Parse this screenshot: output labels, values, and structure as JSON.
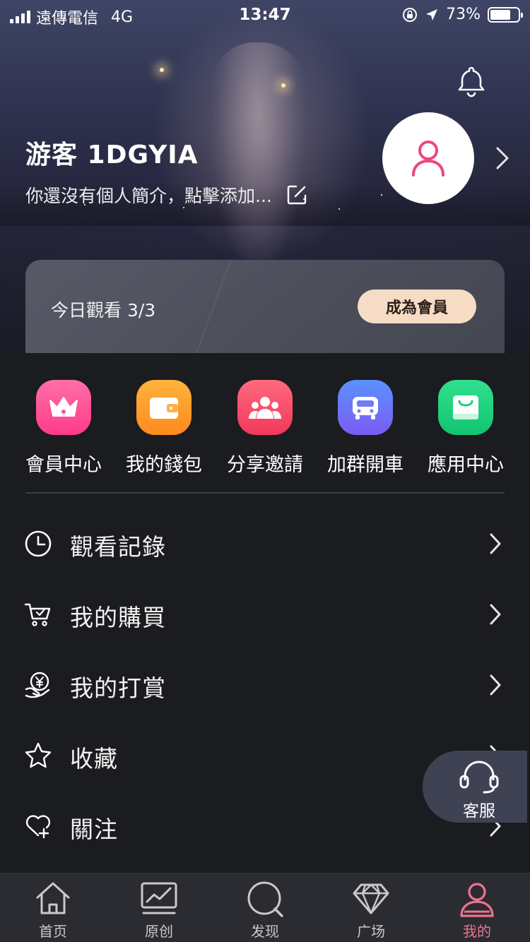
{
  "status_bar": {
    "carrier": "遠傳電信",
    "network": "4G",
    "time": "13:47",
    "battery": "73%",
    "battery_level": 0.73
  },
  "profile": {
    "username": "游客 1DGYIA",
    "bio": "你還沒有個人簡介，點擊添加...",
    "avatar_icon": "user-icon",
    "accent_color": "#f0457f"
  },
  "vip": {
    "watch_today": "今日觀看 3/3",
    "join_label": "成為會員"
  },
  "quick_actions": [
    {
      "label": "會員中心",
      "icon": "crown-icon",
      "color_top": "#ff6fa8",
      "color_bottom": "#ff3b8a"
    },
    {
      "label": "我的錢包",
      "icon": "wallet-icon",
      "color_top": "#ffb23d",
      "color_bottom": "#ff8a1f"
    },
    {
      "label": "分享邀請",
      "icon": "group-icon",
      "color_top": "#ff6a7f",
      "color_bottom": "#f2385a"
    },
    {
      "label": "加群開車",
      "icon": "car-icon",
      "color_top": "#5a92ff",
      "color_bottom": "#7a5cf2"
    },
    {
      "label": "應用中心",
      "icon": "bag-icon",
      "color_top": "#2fe08e",
      "color_bottom": "#12c46f"
    }
  ],
  "menu": [
    {
      "label": "觀看記錄",
      "icon": "clock-icon"
    },
    {
      "label": "我的購買",
      "icon": "cart-icon"
    },
    {
      "label": "我的打賞",
      "icon": "yen-hand-icon"
    },
    {
      "label": "收藏",
      "icon": "star-icon"
    },
    {
      "label": "關注",
      "icon": "heart-plus-icon"
    }
  ],
  "support": {
    "label": "客服",
    "icon": "headset-icon"
  },
  "tabs": [
    {
      "label": "首页",
      "icon": "home-icon"
    },
    {
      "label": "原创",
      "icon": "chart-icon"
    },
    {
      "label": "发现",
      "icon": "discover-icon"
    },
    {
      "label": "广场",
      "icon": "diamond-icon"
    },
    {
      "label": "我的",
      "icon": "profile-icon",
      "active": true,
      "active_color": "#f0728f"
    }
  ]
}
